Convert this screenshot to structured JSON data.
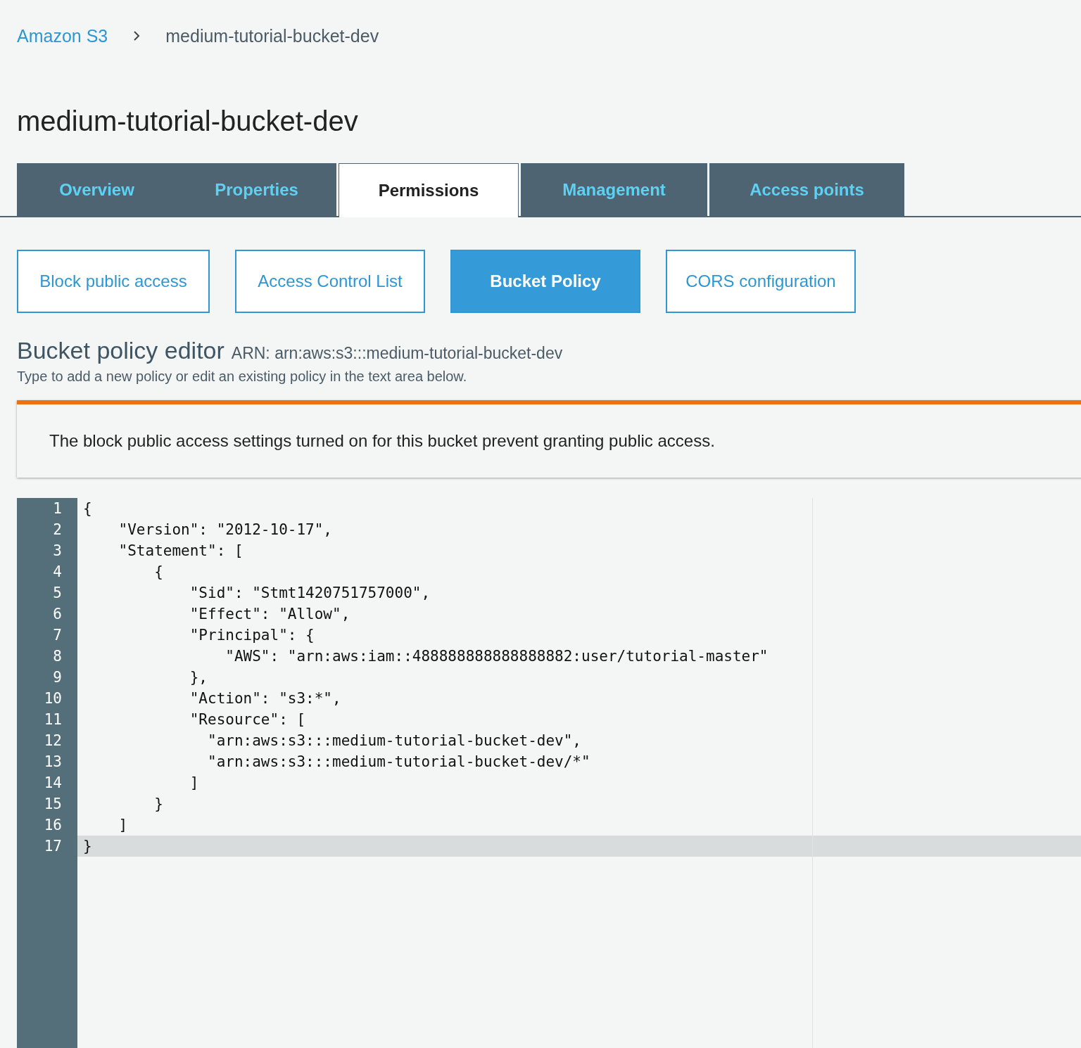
{
  "breadcrumb": [
    {
      "label": "Amazon S3",
      "link": true
    },
    {
      "label": "medium-tutorial-bucket-dev",
      "link": false
    }
  ],
  "title": "medium-tutorial-bucket-dev",
  "tabs": [
    {
      "label": "Overview",
      "selected": false
    },
    {
      "label": "Properties",
      "selected": false
    },
    {
      "label": "Permissions",
      "selected": true
    },
    {
      "label": "Management",
      "selected": false
    },
    {
      "label": "Access points",
      "selected": false
    }
  ],
  "subtabs": [
    {
      "label": "Block public access",
      "selected": false
    },
    {
      "label": "Access Control List",
      "selected": false
    },
    {
      "label": "Bucket Policy",
      "selected": true
    },
    {
      "label": "CORS configuration",
      "selected": false
    }
  ],
  "editor_heading": {
    "title": "Bucket policy editor",
    "arn": "ARN: arn:aws:s3:::medium-tutorial-bucket-dev",
    "hint": "Type to add a new policy or edit an existing policy in the text area below."
  },
  "warning": "The block public access settings turned on for this bucket prevent granting public access.",
  "code_lines": [
    {
      "number": "1",
      "text": "{",
      "current": false
    },
    {
      "number": "2",
      "text": "    \"Version\": \"2012-10-17\",",
      "current": false
    },
    {
      "number": "3",
      "text": "    \"Statement\": [",
      "current": false
    },
    {
      "number": "4",
      "text": "        {",
      "current": false
    },
    {
      "number": "5",
      "text": "            \"Sid\": \"Stmt1420751757000\",",
      "current": false
    },
    {
      "number": "6",
      "text": "            \"Effect\": \"Allow\",",
      "current": false
    },
    {
      "number": "7",
      "text": "            \"Principal\": {",
      "current": false
    },
    {
      "number": "8",
      "text": "                \"AWS\": \"arn:aws:iam::488888888888888882:user/tutorial-master\"",
      "current": false
    },
    {
      "number": "9",
      "text": "            },",
      "current": false
    },
    {
      "number": "10",
      "text": "            \"Action\": \"s3:*\",",
      "current": false
    },
    {
      "number": "11",
      "text": "            \"Resource\": [",
      "current": false
    },
    {
      "number": "12",
      "text": "              \"arn:aws:s3:::medium-tutorial-bucket-dev\",",
      "current": false
    },
    {
      "number": "13",
      "text": "              \"arn:aws:s3:::medium-tutorial-bucket-dev/*\"",
      "current": false
    },
    {
      "number": "14",
      "text": "            ]",
      "current": false
    },
    {
      "number": "15",
      "text": "        }",
      "current": false
    },
    {
      "number": "16",
      "text": "    ]",
      "current": false
    },
    {
      "number": "17",
      "text": "}",
      "current": true
    }
  ]
}
